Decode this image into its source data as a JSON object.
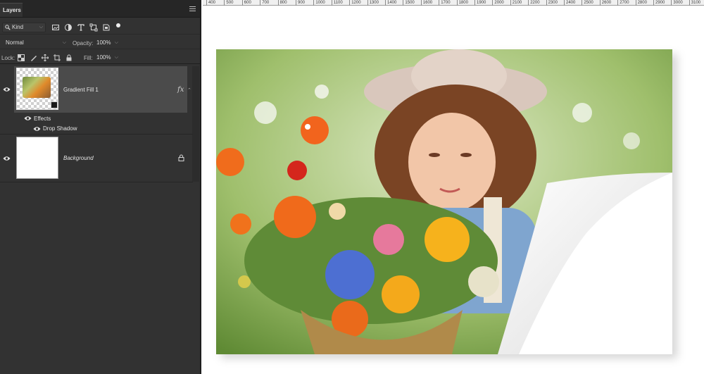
{
  "panel": {
    "tab_label": "Layers",
    "menu_icon": "hamburger-icon",
    "filter": {
      "value": "Kind",
      "icon": "search-icon"
    },
    "filter_icons": [
      "image-filter-icon",
      "adjustment-filter-icon",
      "type-filter-icon",
      "shape-filter-icon",
      "smart-object-filter-icon",
      "filter-toggle-dot-icon"
    ],
    "blend_mode": "Normal",
    "opacity_label": "Opacity:",
    "opacity_value": "100%",
    "lock_label": "Lock:",
    "lock_icons": [
      "lock-transparent-pixels-icon",
      "lock-image-pixels-icon",
      "lock-position-icon",
      "lock-artboard-icon",
      "lock-all-icon"
    ],
    "fill_label": "Fill:",
    "fill_value": "100%"
  },
  "layers": [
    {
      "name": "Gradient Fill 1",
      "fx": "fx",
      "selected": true,
      "effects_label": "Effects",
      "effects": [
        "Drop Shadow"
      ]
    },
    {
      "name": "Background",
      "locked": true
    }
  ],
  "ruler": {
    "ticks": [
      "400",
      "500",
      "600",
      "700",
      "800",
      "900",
      "1000",
      "1100",
      "1200",
      "1300",
      "1400",
      "1500",
      "1600",
      "1700",
      "1800",
      "1900",
      "2000",
      "2100",
      "2200",
      "2300",
      "2400",
      "2500",
      "2600",
      "2700",
      "2800",
      "2900",
      "3000",
      "3100"
    ]
  },
  "canvas": {
    "image_description_icon": "photo-girl-with-flower-basket",
    "page_curl": true,
    "colors": {
      "panel_bg": "#323232",
      "selected_layer": "#4b4b4b",
      "canvas_bg": "#ffffff"
    }
  }
}
